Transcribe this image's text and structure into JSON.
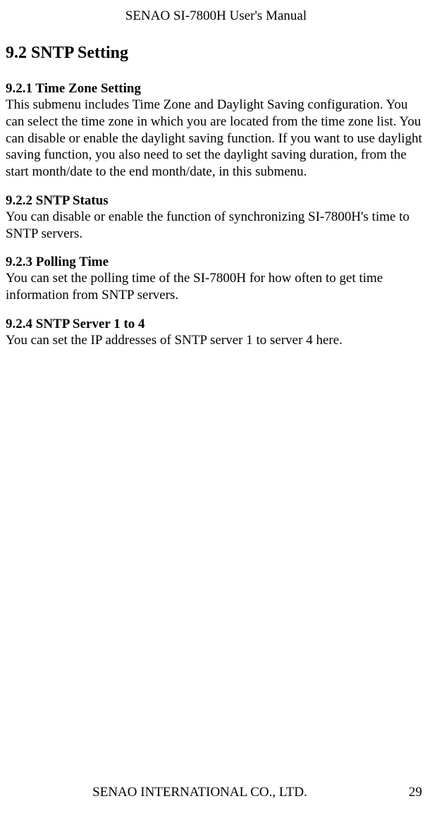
{
  "header": {
    "title": "SENAO SI-7800H User's Manual"
  },
  "section": {
    "heading": "9.2 SNTP Setting"
  },
  "subsections": [
    {
      "heading": "9.2.1 Time Zone Setting",
      "body": "This submenu includes Time Zone and Daylight Saving configuration. You can select the time zone in which you are located from the time zone list. You can disable or enable the daylight saving function. If you want to use daylight saving function, you also need to set the daylight saving duration, from the start month/date to the end month/date, in this submenu."
    },
    {
      "heading": "9.2.2 SNTP Status",
      "body": "You can disable or enable the function of synchronizing SI-7800H's time to SNTP servers."
    },
    {
      "heading": "9.2.3 Polling Time",
      "body": "You can set the polling time of the SI-7800H for how often to get time information from SNTP servers."
    },
    {
      "heading": "9.2.4 SNTP Server 1 to 4",
      "body": "You can set the IP addresses of SNTP server 1 to server 4 here."
    }
  ],
  "footer": {
    "company": "SENAO INTERNATIONAL CO., LTD.",
    "page": "29"
  }
}
